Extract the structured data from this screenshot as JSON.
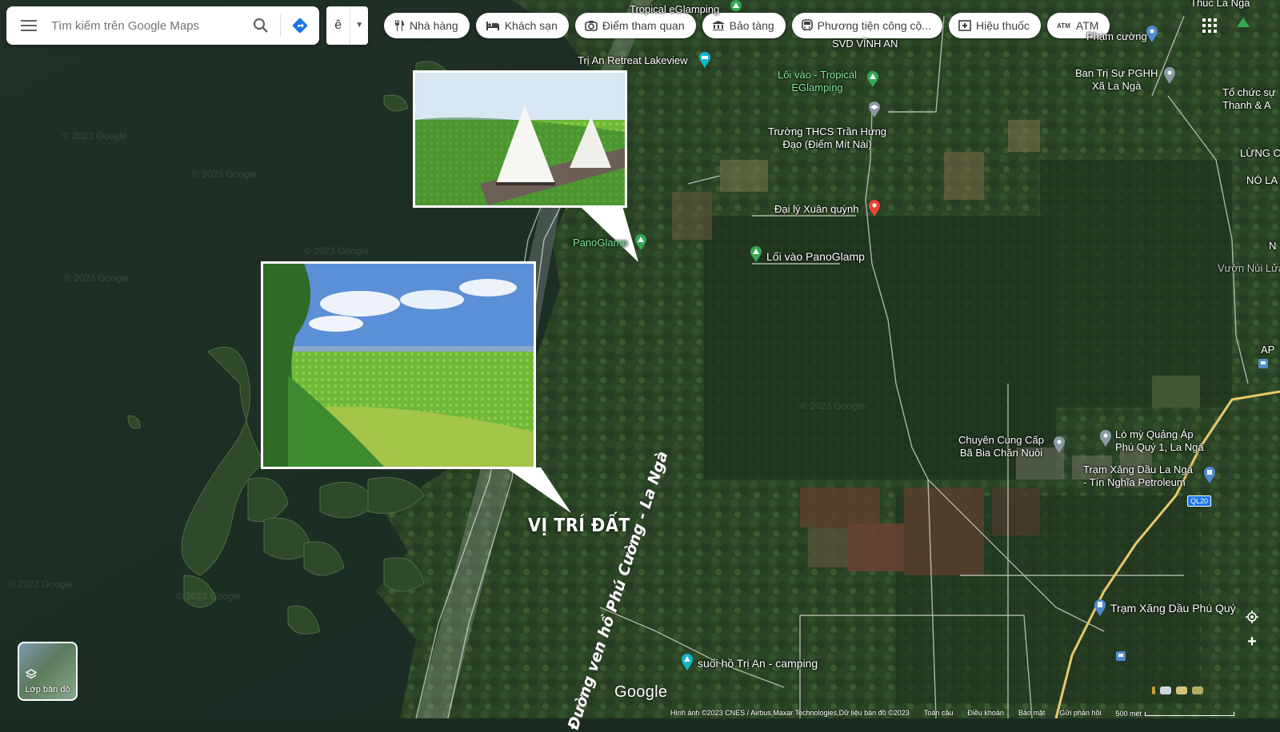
{
  "search": {
    "placeholder": "Tìm kiếm trên Google Maps"
  },
  "language": {
    "value": "ê"
  },
  "chips": [
    {
      "label": "Nhà hàng",
      "icon": "restaurant-icon"
    },
    {
      "label": "Khách sạn",
      "icon": "hotel-icon"
    },
    {
      "label": "Điểm tham quan",
      "icon": "camera-icon"
    },
    {
      "label": "Bảo tàng",
      "icon": "museum-icon"
    },
    {
      "label": "Phương tiện công cộ...",
      "icon": "transit-icon"
    },
    {
      "label": "Hiệu thuốc",
      "icon": "pharmacy-icon"
    },
    {
      "label": "ATM",
      "icon": "atm-icon"
    }
  ],
  "places": {
    "tropical_top": "Tropical eGlamping",
    "thuc_la_nga": "Thuc La Nga",
    "svd": "SVD VĨNH AN",
    "pham_cuong": "Phạm cường",
    "retreat": "Trị An Retreat Lakeview",
    "loi_vao_tropical": "Lối vào - Tropical\nEGlamping",
    "ban_tri": "Ban Trị Sự PGHH\nXã La Ngà",
    "to_chuc": "Tổ chức sự\nThanh & A",
    "truong": "Trường THCS Trần Hưng\nĐạo (Điểm Mít Nài)",
    "lung": "LỪNG C",
    "no_la": "NÓ LA",
    "dai_ly": "Đại lý Xuân quỳnh",
    "panoglamp": "PanoGlamp",
    "loi_vao_pano": "Lối vào PanoGlamp",
    "vuon_nui": "Vườn Núi Lửa",
    "n_edge": "N",
    "ap": "AP",
    "chuyen_cung": "Chuyên Cung Cấp\nBã Bia Chăn Nuôi",
    "lo_my": "Lò mỳ Quảng Áp\nPhú Quý 1, La Ngà",
    "tram_xang_la_nga": "Trạm Xăng Dầu La Ngà\n- Tín Nghĩa Petroleum",
    "ql20": "QL20",
    "tram_xang_phu_quy": "Trạm Xăng Dầu Phú Quý",
    "suoi_ho": "suối hồ Trị An - camping"
  },
  "overlay": {
    "vi_tri": "VỊ TRÍ ĐẤT",
    "road": "Đường ven hồ Phú Cường - La Ngà"
  },
  "layers_label": "Lớp bản đồ",
  "google": "Google",
  "footer": {
    "attribution": "Hình ảnh ©2023 CNES / Airbus,Maxar Technologies,Dữ liệu bản đồ ©2023",
    "global": "Toàn cầu",
    "terms": "Điều khoản",
    "privacy": "Bảo mật",
    "feedback": "Gửi phản hồi",
    "scale": "500 mét"
  },
  "colors": {
    "green_pin": "#34a853",
    "red_pin": "#ea4335",
    "blue_pin": "#4e8ccf",
    "teal_pin": "#12b5cb"
  }
}
